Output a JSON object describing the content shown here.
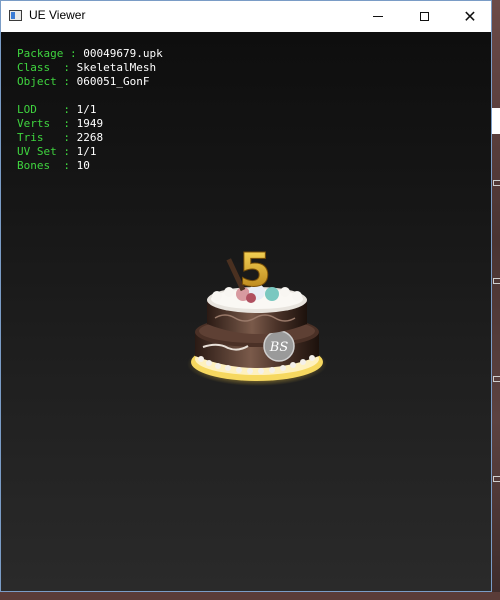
{
  "window": {
    "title": "UE Viewer",
    "minimize_label": "minimize",
    "maximize_label": "maximize",
    "close_glyph": "✕"
  },
  "info": {
    "package": {
      "label": "Package",
      "value": "00049679.upk"
    },
    "class": {
      "label": "Class  ",
      "value": "SkeletalMesh"
    },
    "object": {
      "label": "Object ",
      "value": "060051_GonF"
    },
    "lod": {
      "label": "LOD    ",
      "value": "1/1"
    },
    "verts": {
      "label": "Verts  ",
      "value": "1949"
    },
    "tris": {
      "label": "Tris   ",
      "value": "2268"
    },
    "uvset": {
      "label": "UV Set ",
      "value": "1/1"
    },
    "bones": {
      "label": "Bones  ",
      "value": "10"
    }
  },
  "model": {
    "candle_text": "5",
    "badge_text": "BS"
  },
  "colors": {
    "label_green": "#3fd43f",
    "value_white": "#ffffff",
    "viewport_bg": "#141414",
    "candle_gold": "#e0b020"
  },
  "icons": [
    "app-icon",
    "minimize-icon",
    "maximize-icon",
    "close-icon"
  ]
}
